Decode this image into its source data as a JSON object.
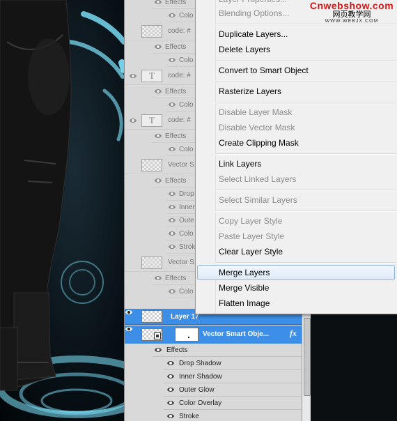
{
  "watermark": {
    "site": "Cnwebshow.com",
    "chinese": "网页教学网",
    "url": "WWW.WEBJX.COM"
  },
  "context_menu": {
    "items": [
      {
        "label": "Layer Properties...",
        "enabled": false
      },
      {
        "label": "Blending Options...",
        "enabled": false
      },
      {
        "label": "Duplicate Layers...",
        "enabled": true
      },
      {
        "label": "Delete Layers",
        "enabled": true
      },
      {
        "label": "Convert to Smart Object",
        "enabled": true
      },
      {
        "label": "Rasterize Layers",
        "enabled": true
      },
      {
        "label": "Disable Layer Mask",
        "enabled": false
      },
      {
        "label": "Disable Vector Mask",
        "enabled": false
      },
      {
        "label": "Create Clipping Mask",
        "enabled": true
      },
      {
        "label": "Link Layers",
        "enabled": true
      },
      {
        "label": "Select Linked Layers",
        "enabled": false
      },
      {
        "label": "Select Similar Layers",
        "enabled": false
      },
      {
        "label": "Copy Layer Style",
        "enabled": false
      },
      {
        "label": "Paste Layer Style",
        "enabled": false
      },
      {
        "label": "Clear Layer Style",
        "enabled": true
      },
      {
        "label": "Merge Layers",
        "enabled": true,
        "highlighted": true
      },
      {
        "label": "Merge Visible",
        "enabled": true
      },
      {
        "label": "Flatten Image",
        "enabled": true
      }
    ]
  },
  "layers_panel": {
    "faded_rows": [
      {
        "kind": "sub",
        "label": "Effects"
      },
      {
        "kind": "sub2",
        "label": "Colo"
      },
      {
        "kind": "layer",
        "label": "code: #"
      },
      {
        "kind": "sub",
        "label": "Effects"
      },
      {
        "kind": "sub2",
        "label": "Colo"
      },
      {
        "kind": "layer-t",
        "label": "code: #"
      },
      {
        "kind": "sub",
        "label": "Effects"
      },
      {
        "kind": "sub2",
        "label": "Colo"
      },
      {
        "kind": "layer-t",
        "label": "code: #"
      },
      {
        "kind": "sub",
        "label": "Effects"
      },
      {
        "kind": "sub2",
        "label": "Colo"
      },
      {
        "kind": "layer-v",
        "label": "Vector S"
      },
      {
        "kind": "sub",
        "label": "Effects"
      },
      {
        "kind": "sub2",
        "label": "Drop"
      },
      {
        "kind": "sub2",
        "label": "Inner"
      },
      {
        "kind": "sub2",
        "label": "Oute"
      },
      {
        "kind": "sub2",
        "label": "Colo"
      },
      {
        "kind": "sub2",
        "label": "Strok"
      },
      {
        "kind": "layer",
        "label": "Vector S"
      },
      {
        "kind": "sub",
        "label": "Effects"
      },
      {
        "kind": "sub2",
        "label": "Colo"
      }
    ],
    "selected_layers": [
      {
        "name": "Layer 17",
        "fx": ""
      },
      {
        "name": "Vector Smart Obje...",
        "fx": "fx"
      }
    ],
    "effects_label": "Effects",
    "effects": [
      "Drop Shadow",
      "Inner Shadow",
      "Outer Glow",
      "Color Overlay",
      "Stroke"
    ]
  },
  "colors": {
    "selection_blue": "#3d8ee6",
    "watermark_red": "#d01818",
    "glow_cyan": "#7fe6ff"
  }
}
